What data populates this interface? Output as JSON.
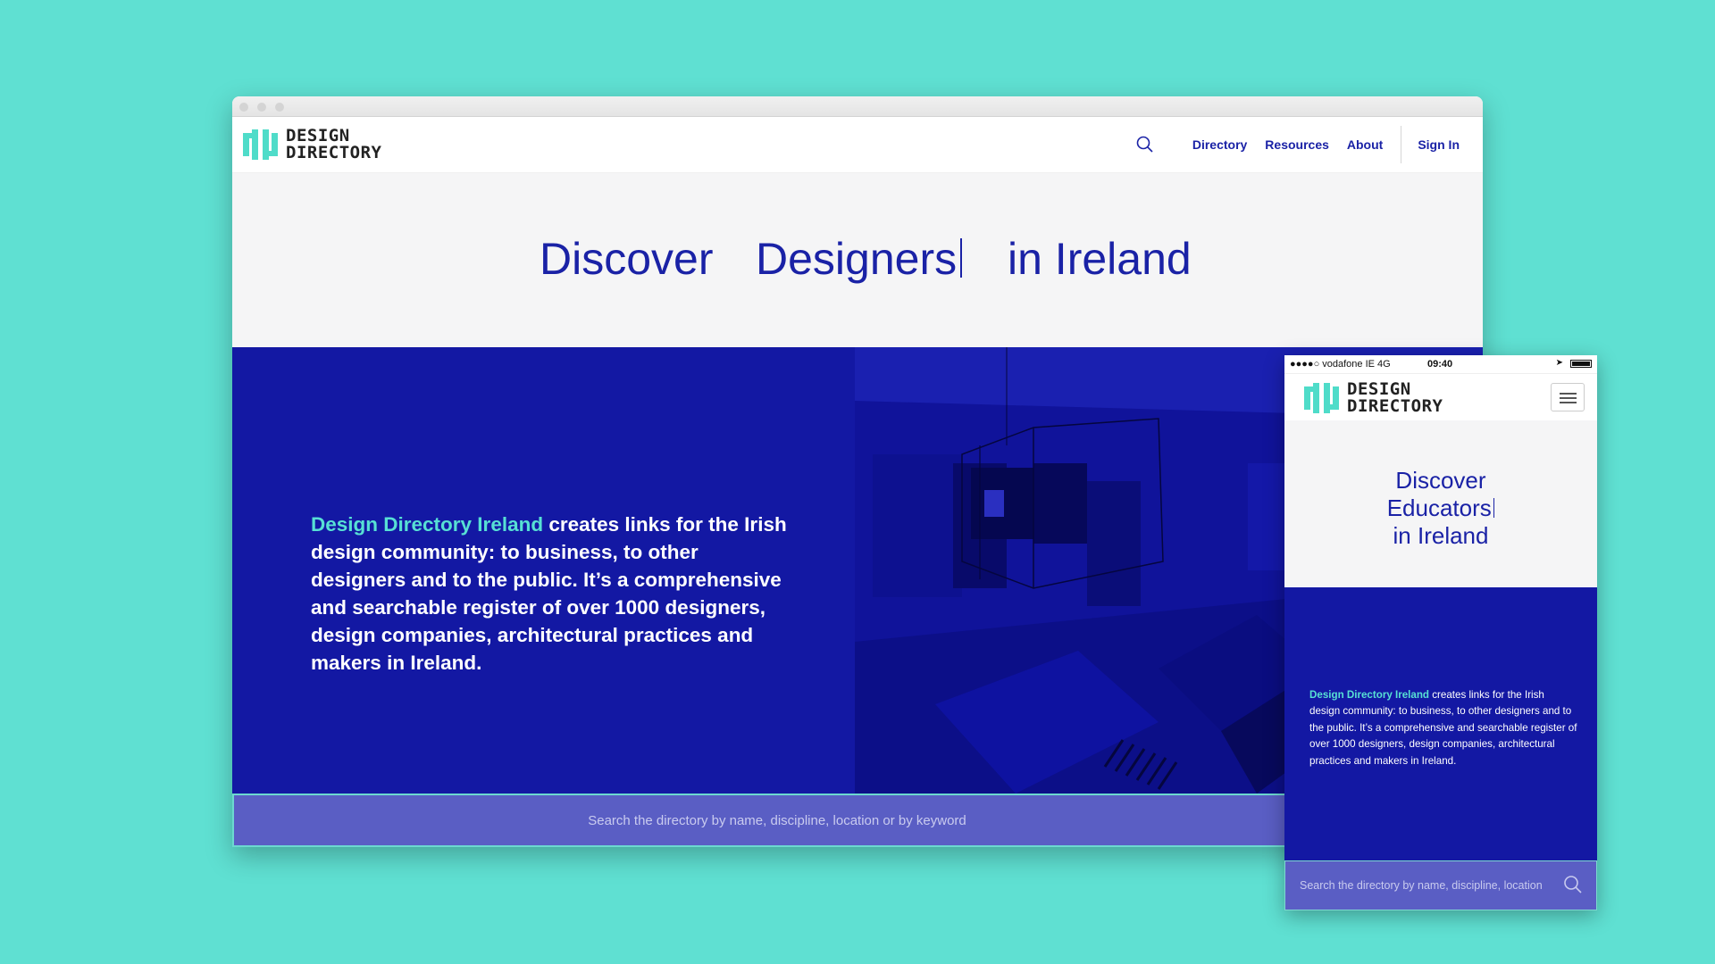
{
  "colors": {
    "background": "#5fe0d2",
    "brand_blue": "#1a22a6",
    "band_blue": "#1318a3",
    "accent_teal": "#57e0d4",
    "search_bar": "#5a5ec4"
  },
  "brand": {
    "line1": "DESIGN",
    "line2": "DIRECTORY"
  },
  "desktop": {
    "nav": {
      "search_icon": "search-icon",
      "links": [
        "Directory",
        "Resources",
        "About"
      ],
      "sign_in": "Sign In"
    },
    "hero": {
      "word1": "Discover",
      "word2": "Designers",
      "word3": "in Ireland"
    },
    "intro": {
      "highlight": "Design Directory Ireland",
      "text": " creates links for the Irish design community: to business, to other designers and to the public. It’s a comprehensive and searchable register of over 1000 designers, design companies, architectural practices and makers in Ireland."
    },
    "search_placeholder": "Search the directory by name, discipline, location or by keyword"
  },
  "phone": {
    "status": {
      "carrier": "●●●●○ vodafone IE   4G",
      "time": "09:40"
    },
    "menu_icon": "hamburger-menu-icon",
    "hero": {
      "line1": "Discover",
      "line2": "Educators",
      "line3": "in Ireland"
    },
    "intro": {
      "highlight": "Design Directory Ireland",
      "text": " creates links for the Irish design community: to business, to other designers and to the public. It’s a comprehensive and searchable register of over 1000 designers, design companies, architectural practices and makers in Ireland."
    },
    "search_placeholder": "Search the directory by name, discipline, location",
    "search_icon": "search-icon"
  }
}
